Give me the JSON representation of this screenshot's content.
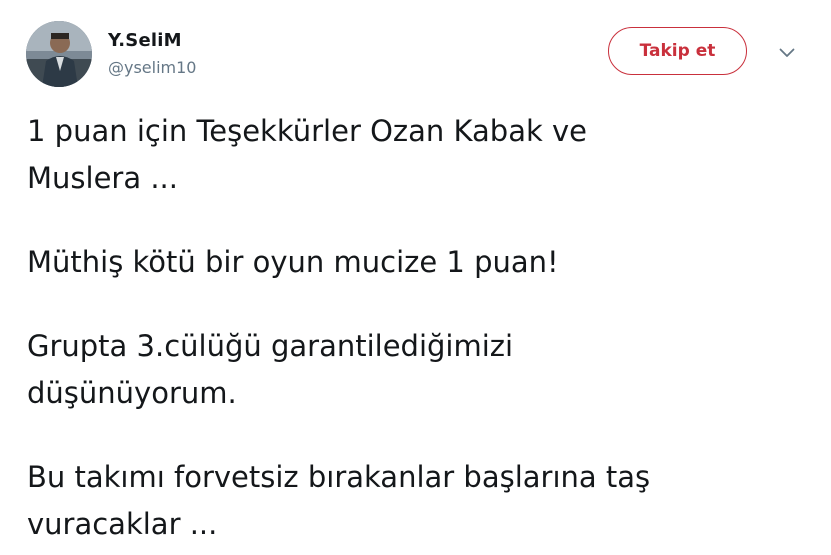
{
  "user": {
    "name": "Y.SeliM",
    "handle": "@yselim10"
  },
  "actions": {
    "follow_label": "Takip et",
    "menu_icon": "chevron-down-icon"
  },
  "colors": {
    "accent": "#c9303c",
    "text": "#14171a",
    "muted": "#657786"
  },
  "tweet": {
    "paragraphs": [
      [
        "1 puan için Teşekkürler Ozan Kabak ve",
        "Muslera ..."
      ],
      [
        "Müthiş kötü bir oyun mucize 1 puan!"
      ],
      [
        "Grupta 3.cülüğü garantilediğimizi",
        "düşünüyorum."
      ],
      [
        "Bu takımı forvetsiz bırakanlar başlarına taş",
        "vuracaklar ..."
      ]
    ]
  }
}
